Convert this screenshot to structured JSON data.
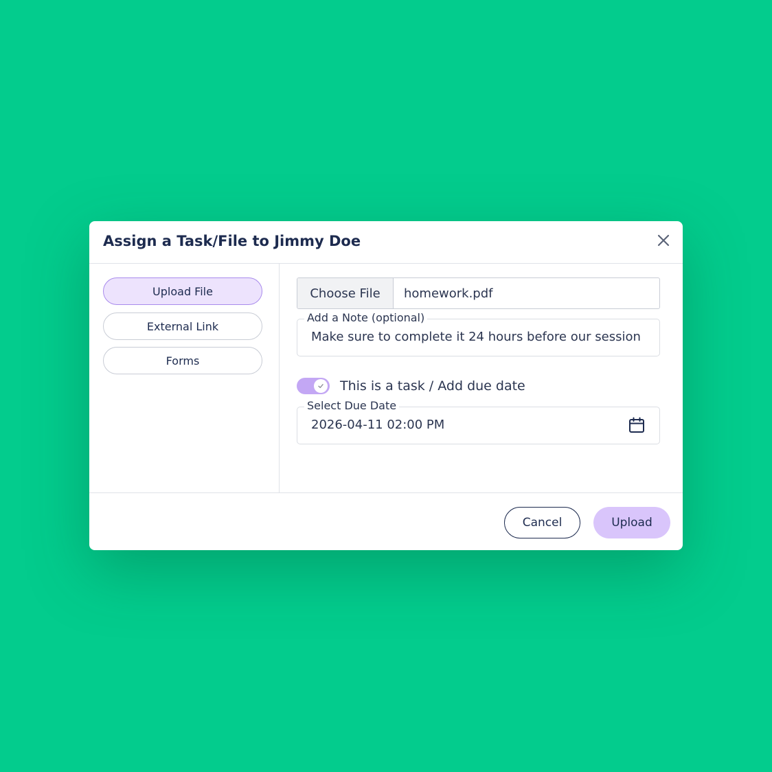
{
  "modal": {
    "title": "Assign a Task/File to Jimmy Doe"
  },
  "sidebar": {
    "items": [
      {
        "label": "Upload File",
        "active": true
      },
      {
        "label": "External Link",
        "active": false
      },
      {
        "label": "Forms",
        "active": false
      }
    ]
  },
  "file_input": {
    "button_label": "Choose File",
    "file_name": "homework.pdf"
  },
  "note": {
    "label": "Add a Note (optional)",
    "value": "Make sure to complete it 24 hours before our session"
  },
  "task_toggle": {
    "label": "This is a task / Add due date",
    "checked": true
  },
  "due_date": {
    "label": "Select Due Date",
    "value": "2026-04-11 02:00 PM"
  },
  "footer": {
    "cancel_label": "Cancel",
    "upload_label": "Upload"
  },
  "icons": {
    "close": "close-icon",
    "check": "check-icon",
    "calendar": "calendar-icon"
  },
  "colors": {
    "background": "#03cc8d",
    "accent": "#c3a7f4",
    "active_item": "#ede3fd",
    "upload_button": "#d9c5fb",
    "text": "#1d2b4f"
  }
}
